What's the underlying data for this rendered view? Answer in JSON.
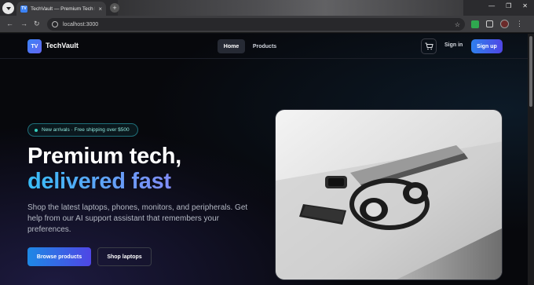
{
  "browser": {
    "tab_title": "TechVault — Premium Tech Pr...",
    "tab_favicon": "TV",
    "url": "localhost:3000"
  },
  "nav": {
    "logo_badge": "TV",
    "brand": "TechVault",
    "links": [
      "Home",
      "Products"
    ],
    "signin": "Sign in",
    "signup": "Sign up"
  },
  "hero": {
    "pill": "New arrivals · Free shipping over $500",
    "title_line1": "Premium tech,",
    "title_line2": "delivered fast",
    "description": "Shop the latest laptops, phones, monitors, and peripherals. Get help from our AI support assistant that remembers your preferences.",
    "primary_cta": "Browse products",
    "secondary_cta": "Shop laptops"
  },
  "colors": {
    "accent_blue": "#2f80ed",
    "accent_indigo": "#4f46e5",
    "pill_teal": "#35d0c0"
  }
}
